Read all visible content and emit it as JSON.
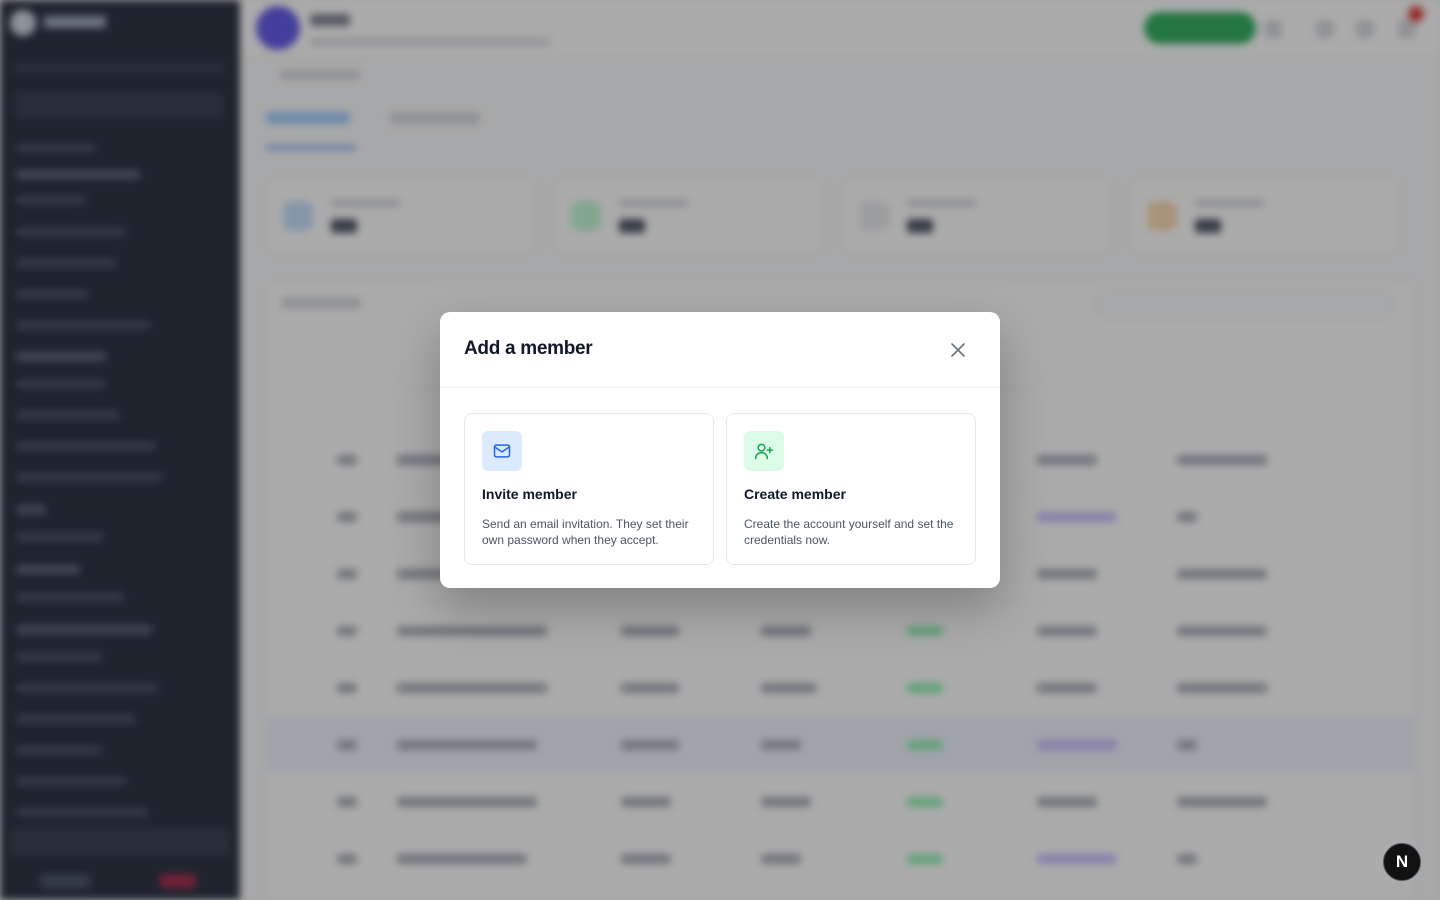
{
  "modal": {
    "title": "Add a member",
    "options": [
      {
        "title": "Invite member",
        "description": "Send an email invitation. They set their own password when they accept.",
        "icon": "mail-icon",
        "icon_bg": "#dbeafe",
        "icon_color": "#2563eb"
      },
      {
        "title": "Create member",
        "description": "Create the account yourself and set the credentials now.",
        "icon": "user-plus-icon",
        "icon_bg": "#dcfce7",
        "icon_color": "#16a34a"
      }
    ]
  },
  "floating_badge": {
    "label": "N"
  },
  "colors": {
    "sidebar_bg": "#0f172a",
    "accent_blue": "#3b82f6",
    "accent_green": "#16a34a",
    "avatar": "#4f46e5"
  }
}
